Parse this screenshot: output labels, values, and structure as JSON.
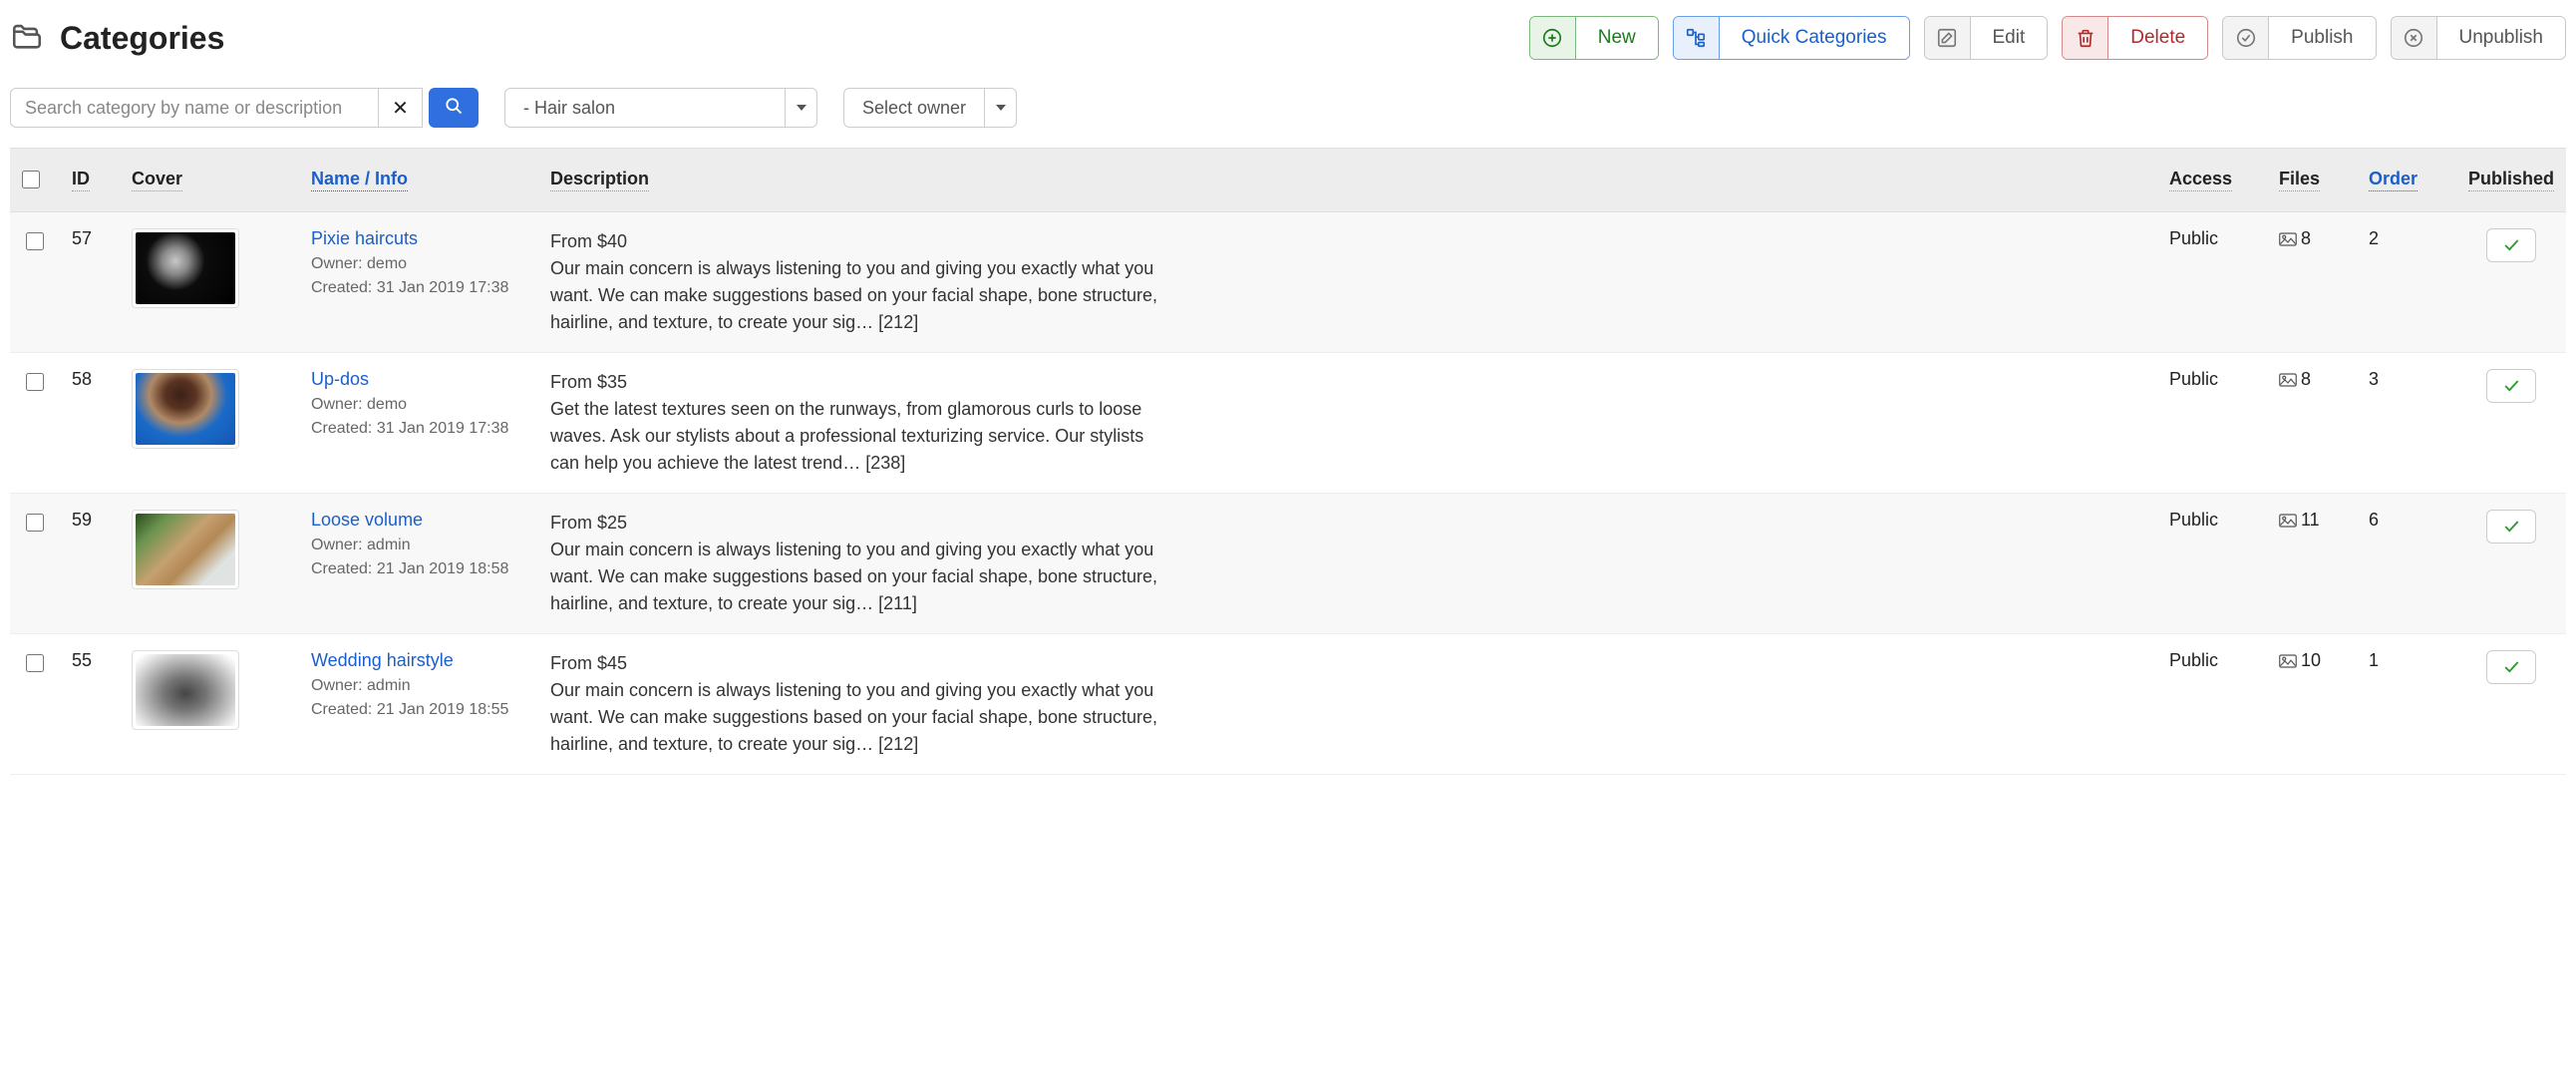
{
  "page": {
    "title": "Categories"
  },
  "toolbar": {
    "new": "New",
    "quick": "Quick Categories",
    "edit": "Edit",
    "delete": "Delete",
    "publish": "Publish",
    "unpublish": "Unpublish"
  },
  "filters": {
    "search_placeholder": "Search category by name or description",
    "category_selected": "- Hair salon",
    "owner_placeholder": "Select owner"
  },
  "columns": {
    "id": "ID",
    "cover": "Cover",
    "name": "Name / Info",
    "description": "Description",
    "access": "Access",
    "files": "Files",
    "order": "Order",
    "published": "Published"
  },
  "labels": {
    "owner_prefix": "Owner: ",
    "created_prefix": "Created: "
  },
  "rows": [
    {
      "id": "57",
      "name": "Pixie haircuts",
      "owner": "demo",
      "created": "31 Jan 2019 17:38",
      "description": "From $40\nOur main concern is always listening to you and giving you exactly what you want. We can make suggestions based on your facial shape, bone structure, hairline, and texture, to create your sig… [212]",
      "access": "Public",
      "files": "8",
      "order": "2",
      "cover_class": "cover-1"
    },
    {
      "id": "58",
      "name": "Up-dos",
      "owner": "demo",
      "created": "31 Jan 2019 17:38",
      "description": "From $35\nGet the latest textures seen on the runways, from glamorous curls to loose waves. Ask our stylists about a professional texturizing service. Our stylists can help you achieve the latest trend… [238]",
      "access": "Public",
      "files": "8",
      "order": "3",
      "cover_class": "cover-2"
    },
    {
      "id": "59",
      "name": "Loose volume",
      "owner": "admin",
      "created": "21 Jan 2019 18:58",
      "description": "From $25\nOur main concern is always listening to you and giving you exactly what you want. We can make suggestions based on your facial shape, bone structure, hairline, and texture, to create your sig… [211]",
      "access": "Public",
      "files": "11",
      "order": "6",
      "cover_class": "cover-3"
    },
    {
      "id": "55",
      "name": "Wedding hairstyle",
      "owner": "admin",
      "created": "21 Jan 2019 18:55",
      "description": "From $45\nOur main concern is always listening to you and giving you exactly what you want. We can make suggestions based on your facial shape, bone structure, hairline, and texture, to create your sig… [212]",
      "access": "Public",
      "files": "10",
      "order": "1",
      "cover_class": "cover-4"
    }
  ]
}
